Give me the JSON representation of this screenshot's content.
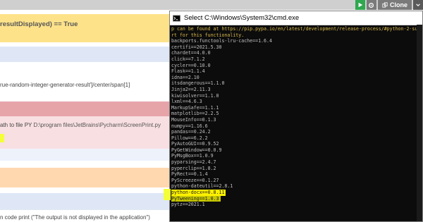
{
  "topbar": {
    "run_icon": "play-icon",
    "settings_icon": "gear-icon",
    "clone_label": "Clone",
    "clone_icon": "clone-icon",
    "chevron_icon": "chevron-down-icon"
  },
  "page": {
    "band_yellow_text": "resultDisplayed) == True",
    "band_xpath_text": "rue-random-integer-generator-result']/center/span[1]",
    "band_path_prefix": "ath to file PY ",
    "band_path_value": "D:\\program files\\JetBrains\\Pycharm\\ScreenPrint.py",
    "bottom_prefix": "n code ",
    "bottom_code": "print (\"The output is not displayed in the application\")"
  },
  "cmd": {
    "title": "Select C:\\Windows\\System32\\cmd.exe",
    "lines": [
      {
        "text": "p can be found at https://pip.pypa.io/en/latest/development/release-process/#python-2-sup",
        "style": "gold"
      },
      {
        "text": "rt for this functionality.",
        "style": "gold"
      },
      {
        "text": "backports.functools-lru-cache==1.6.4",
        "style": ""
      },
      {
        "text": "certifi==2021.5.30",
        "style": ""
      },
      {
        "text": "chardet==4.0.0",
        "style": ""
      },
      {
        "text": "click==7.1.2",
        "style": ""
      },
      {
        "text": "cycler==0.10.0",
        "style": ""
      },
      {
        "text": "Flask==1.1.4",
        "style": ""
      },
      {
        "text": "idna==2.10",
        "style": ""
      },
      {
        "text": "itsdangerous==1.1.0",
        "style": ""
      },
      {
        "text": "Jinja2==2.11.3",
        "style": ""
      },
      {
        "text": "kiwisolver==1.1.0",
        "style": ""
      },
      {
        "text": "lxml==4.6.3",
        "style": ""
      },
      {
        "text": "MarkupSafe==1.1.1",
        "style": ""
      },
      {
        "text": "matplotlib==2.2.5",
        "style": ""
      },
      {
        "text": "MouseInfo==0.1.3",
        "style": ""
      },
      {
        "text": "numpy==1.16.6",
        "style": ""
      },
      {
        "text": "pandas==0.24.2",
        "style": ""
      },
      {
        "text": "Pillow==6.2.2",
        "style": ""
      },
      {
        "text": "PyAutoGUI==0.9.52",
        "style": ""
      },
      {
        "text": "PyGetWindow==0.0.9",
        "style": ""
      },
      {
        "text": "PyMsgBox==1.0.9",
        "style": ""
      },
      {
        "text": "pyparsing==2.4.7",
        "style": ""
      },
      {
        "text": "pyperclip==1.8.2",
        "style": ""
      },
      {
        "text": "PyRect==0.1.4",
        "style": ""
      },
      {
        "text": "PyScreeze==0.1.27",
        "style": ""
      },
      {
        "text": "python-dateutil==2.8.1",
        "style": ""
      },
      {
        "text": "python-docx==0.8.11",
        "style": "mark"
      },
      {
        "text": "PyTweening==1.0.3",
        "style": "mark-dim"
      },
      {
        "text": "pytz==2021.1",
        "style": ""
      }
    ]
  },
  "colors": {
    "highlight": "#fff200",
    "console_bg": "#0c0c0c",
    "console_text": "#c0c0c0"
  }
}
